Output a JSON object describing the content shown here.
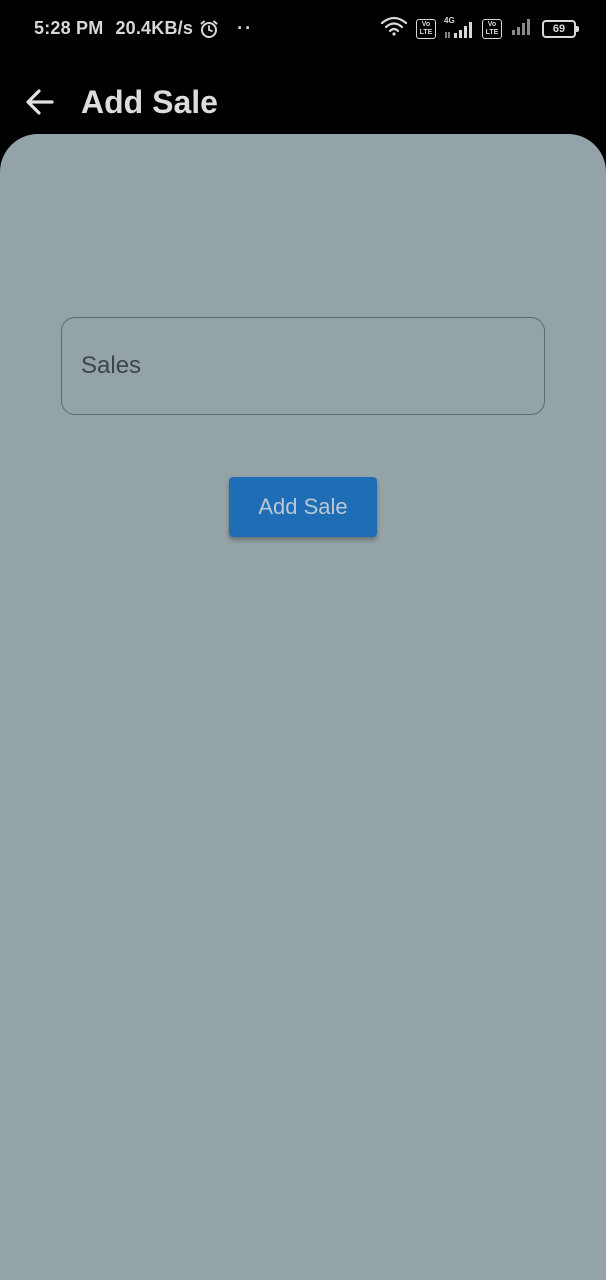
{
  "status_bar": {
    "time": "5:28 PM",
    "network_speed": "20.4KB/s",
    "dots": "··",
    "volte1_top": "Vo",
    "volte1_bottom": "LTE",
    "network_type": "4G",
    "volte2_top": "Vo",
    "volte2_bottom": "LTE",
    "battery_level": "69",
    "icons": [
      "alarm-icon",
      "wifi-icon",
      "volte-icon",
      "signal-icon",
      "battery-icon"
    ]
  },
  "app_bar": {
    "title": "Add Sale",
    "back_icon": "arrow-left-icon"
  },
  "form": {
    "sales_input": {
      "placeholder": "Sales",
      "value": ""
    },
    "submit_label": "Add Sale"
  },
  "colors": {
    "background": "#000000",
    "content_background": "#93a3a7",
    "button": "#1f6db4",
    "button_text": "#b7c9d6"
  }
}
